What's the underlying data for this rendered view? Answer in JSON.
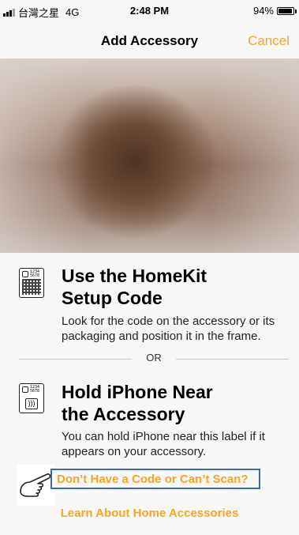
{
  "status_bar": {
    "carrier": "台灣之星",
    "network": "4G",
    "time": "2:48 PM",
    "battery_percent": "94%",
    "battery_level": 0.94
  },
  "nav": {
    "title": "Add Accessory",
    "cancel_label": "Cancel"
  },
  "setup_code": {
    "title_line1": "Use the HomeKit",
    "title_line2": "Setup Code",
    "body": "Look for the code on the accessory or its packaging and position it in the frame.",
    "icon_digits": "1234 5678"
  },
  "divider": {
    "label": "OR"
  },
  "nfc": {
    "title_line1": "Hold iPhone Near",
    "title_line2": "the Accessory",
    "body": "You can hold iPhone near this label if it appears on your accessory.",
    "icon_digits": "1234 5678"
  },
  "links": {
    "no_code": "Don’t Have a Code or Can’t Scan?",
    "learn_more": "Learn About Home Accessories"
  },
  "colors": {
    "accent": "#f5a623",
    "highlight_box": "#3b6aa8"
  }
}
